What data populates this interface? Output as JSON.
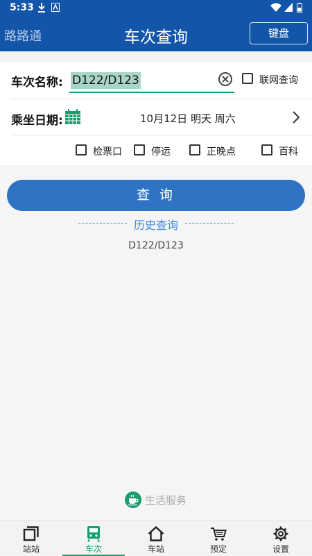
{
  "status_bar": {
    "time": "5:33"
  },
  "app_bar": {
    "brand": "路路通",
    "title": "车次查询",
    "keyboard_button": "键盘"
  },
  "form": {
    "train_label": "车次名称:",
    "train_value": "D122/D123",
    "online_query_label": "联网查询",
    "date_label": "乘坐日期:",
    "date_value": "10月12日 明天 周六",
    "options": [
      "检票口",
      "停运",
      "正晚点",
      "百科"
    ]
  },
  "query_button": "查 询",
  "history": {
    "title": "历史查询",
    "items": [
      "D122/D123"
    ]
  },
  "life_service": "生活服务",
  "tabs": [
    {
      "label": "站站",
      "icon": "station-to-station-icon",
      "active": false
    },
    {
      "label": "车次",
      "icon": "train-icon",
      "active": true
    },
    {
      "label": "车站",
      "icon": "home-station-icon",
      "active": false
    },
    {
      "label": "预定",
      "icon": "cart-icon",
      "active": false
    },
    {
      "label": "设置",
      "icon": "gear-icon",
      "active": false
    }
  ],
  "colors": {
    "primary_blue": "#1355a8",
    "button_blue": "#2f73c4",
    "accent_green": "#1a9e6d",
    "history_blue": "#3a86d6"
  }
}
